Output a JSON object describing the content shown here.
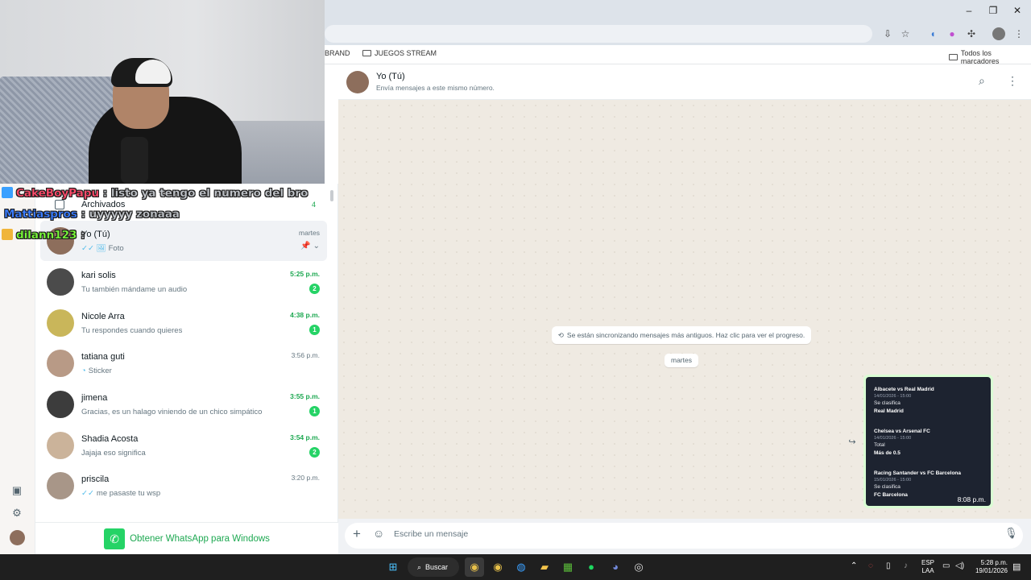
{
  "browser": {
    "bookmarks": [
      {
        "label": "BRAND"
      },
      {
        "label": "JUEGOS STREAM"
      }
    ],
    "all_bookmarks_label": "Todos los marcadores",
    "window_controls": {
      "minimize": "–",
      "maximize": "❐",
      "close": "✕"
    }
  },
  "stream_chat": [
    {
      "user": "CakeBoyPapu",
      "message": ": listo ya tengo el numero del bro",
      "user_color": "#ff4d6d",
      "badge_color": "#3aa0ff"
    },
    {
      "user": "Mattiaspros",
      "message": ": uyyyyy zonaaa",
      "user_color": "#3b7dff",
      "badge_color": ""
    },
    {
      "user": "dilann123",
      "message": ":",
      "user_color": "#7cff3c",
      "badge_color": "#f0b53a"
    }
  ],
  "sidebar": {
    "archived": {
      "label": "Archivados",
      "count": "4"
    },
    "chats": [
      {
        "name": "Yo (Tú)",
        "preview": "Foto",
        "time": "martes",
        "unread": "",
        "status_prefix": "✓✓ 🖼",
        "active": true,
        "avatar": "#8d6e5c"
      },
      {
        "name": "kari solis",
        "preview": "Tu también mándame un audio",
        "time": "5:25 p.m.",
        "unread": "2",
        "status_prefix": "",
        "avatar": "#4b4b4b"
      },
      {
        "name": "Nicole Arra",
        "preview": "Tu respondes cuando quieres",
        "time": "4:38 p.m.",
        "unread": "1",
        "status_prefix": "",
        "avatar": "#c9b65a"
      },
      {
        "name": "tatiana guti",
        "preview": "Sticker",
        "time": "3:56 p.m.",
        "unread": "",
        "status_prefix": "◔",
        "avatar": "#b89a86"
      },
      {
        "name": "jimena",
        "preview": "Gracias, es un halago viniendo de un chico simpático",
        "time": "3:55 p.m.",
        "unread": "1",
        "status_prefix": "",
        "avatar": "#3c3c3c"
      },
      {
        "name": "Shadia Acosta",
        "preview": "Jajaja eso significa",
        "time": "3:54 p.m.",
        "unread": "2",
        "status_prefix": "",
        "avatar": "#cbb39a"
      },
      {
        "name": "priscila",
        "preview": "me pasaste tu wsp",
        "time": "3:20 p.m.",
        "unread": "",
        "status_prefix": "✓✓",
        "avatar": "#a89688"
      }
    ],
    "get_app_label": "Obtener WhatsApp para Windows"
  },
  "conversation": {
    "contact_name": "Yo (Tú)",
    "contact_subtitle": "Envía mensajes a este mismo número.",
    "sync_notice": "Se están sincronizando mensajes más antiguos. Haz clic para ver el progreso.",
    "date_label": "martes",
    "photo_message": {
      "time": "8:08 p.m.",
      "matches": [
        {
          "title": "Albacete  vs  Real Madrid",
          "date": "14/01/2026 - 15:00",
          "pick": "Se clasifica",
          "result": "Real Madrid"
        },
        {
          "title": "Chelsea  vs  Arsenal FC",
          "date": "14/01/2026 - 15:00",
          "pick": "Total",
          "result": "Más de 0.5"
        },
        {
          "title": "Racing Santander  vs  FC Barcelona",
          "date": "15/01/2026 - 15:00",
          "pick": "Se clasifica",
          "result": "FC Barcelona"
        }
      ]
    },
    "composer_placeholder": "Escribe un mensaje"
  },
  "taskbar": {
    "search_label": "Buscar",
    "language": "ESP",
    "language_sub": "LAA",
    "time": "5:28 p.m.",
    "date": "19/01/2026"
  },
  "colors": {
    "whatsapp_green": "#25d366",
    "chat_bg": "#efeae2",
    "taskbar": "#1f1f1f"
  }
}
